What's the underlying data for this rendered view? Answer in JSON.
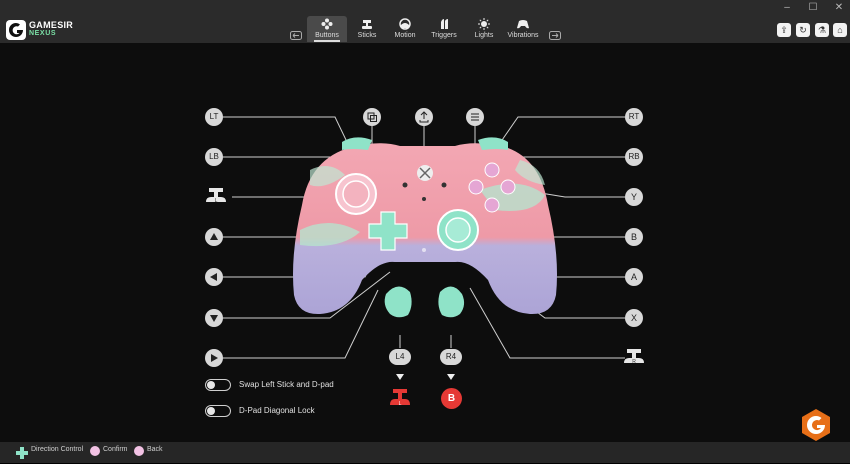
{
  "app": {
    "brand": "GAMESIR",
    "sub": "NEXUS"
  },
  "tabs": [
    {
      "label": "Buttons",
      "icon": "buttons-icon",
      "active": true
    },
    {
      "label": "Sticks",
      "icon": "sticks-icon",
      "active": false
    },
    {
      "label": "Motion",
      "icon": "motion-icon",
      "active": false
    },
    {
      "label": "Triggers",
      "icon": "triggers-icon",
      "active": false
    },
    {
      "label": "Lights",
      "icon": "lights-icon",
      "active": false
    },
    {
      "label": "Vibrations",
      "icon": "vibrations-icon",
      "active": false
    }
  ],
  "mapping": {
    "lt": "LT",
    "lb": "LB",
    "rt": "RT",
    "rb": "RB",
    "y": "Y",
    "b": "B",
    "a": "A",
    "x": "X",
    "l4": "L4",
    "r4": "R4",
    "r4_assigned": "B"
  },
  "toggles": [
    {
      "label": "Swap Left Stick and D-pad",
      "on": false
    },
    {
      "label": "D-Pad Diagonal Lock",
      "on": false
    }
  ],
  "footer": {
    "direction": "Direction Control",
    "confirm": "Confirm",
    "back": "Back"
  },
  "colors": {
    "accent_mint": "#8fe3c8",
    "accent_pink": "#f0a5b8",
    "accent_red": "#e53935",
    "pill_bg": "#d8d8d8"
  }
}
